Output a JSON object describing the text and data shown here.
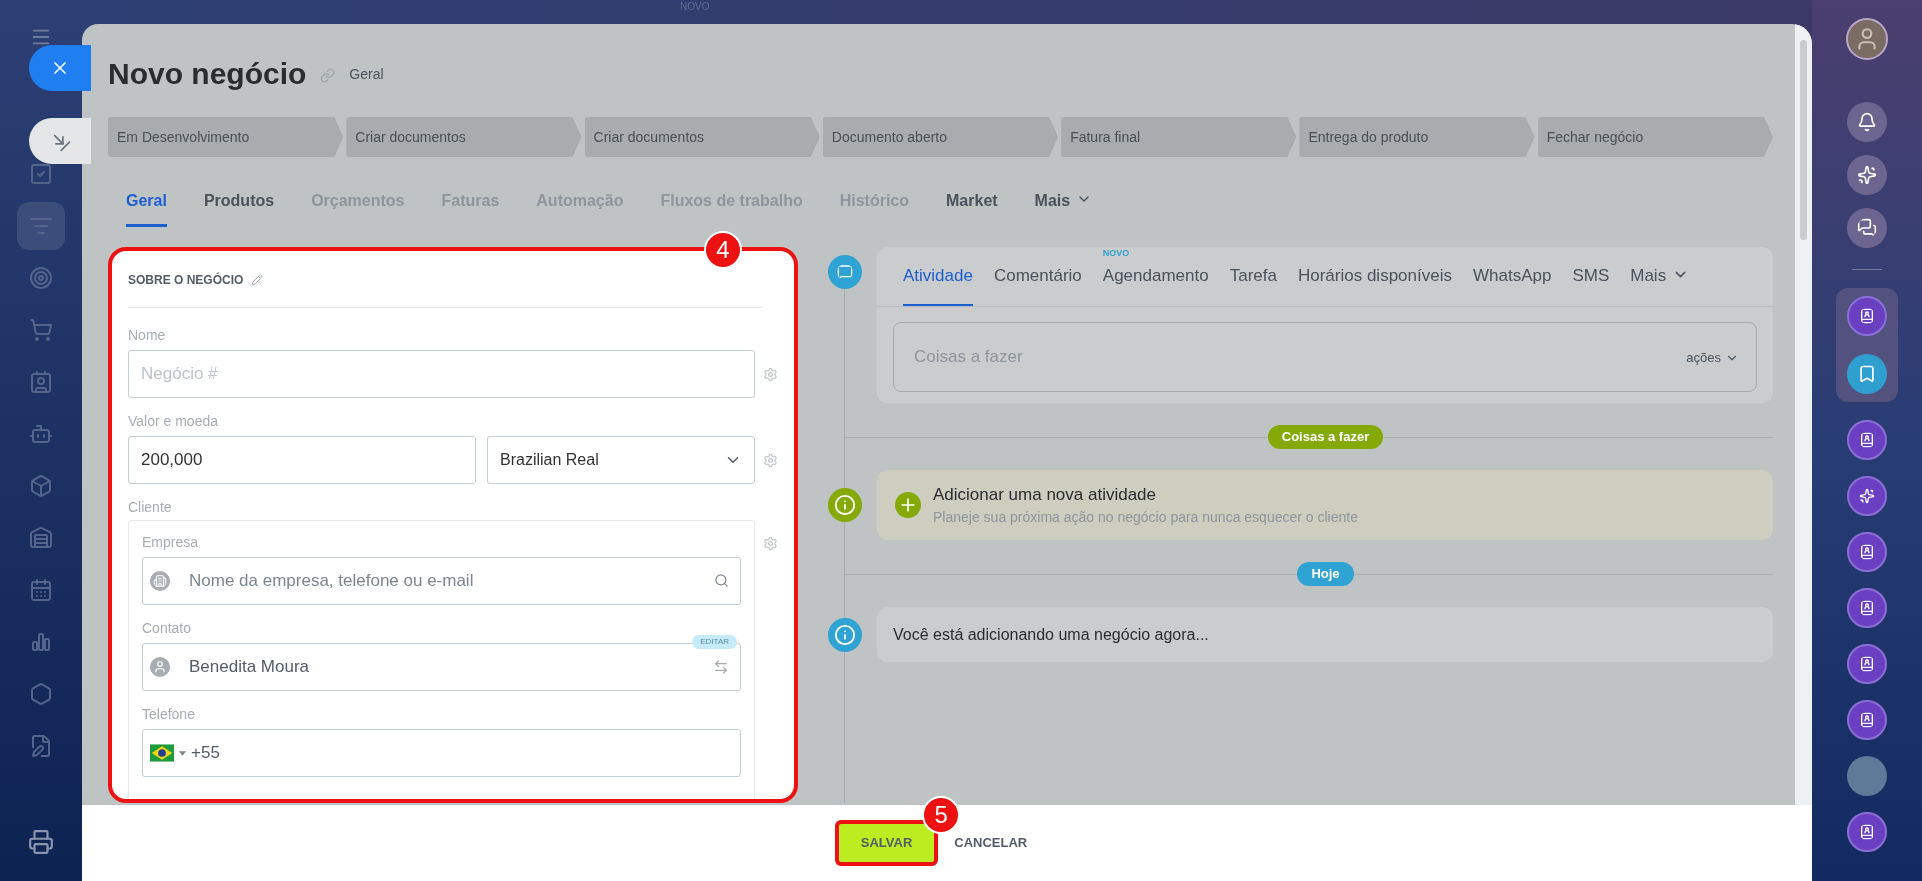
{
  "top_label": "NOVO",
  "title": "Novo negócio",
  "title_tag": "Geral",
  "stages": [
    {
      "label": "Em Desenvolvimento"
    },
    {
      "label": "Criar documentos"
    },
    {
      "label": "Criar documentos"
    },
    {
      "label": "Documento aberto"
    },
    {
      "label": "Fatura final"
    },
    {
      "label": "Entrega do produto"
    },
    {
      "label": "Fechar negócio"
    }
  ],
  "tabs": [
    {
      "label": "Geral",
      "selected": true,
      "disabled": false,
      "kind": "tab"
    },
    {
      "label": "Produtos",
      "selected": false,
      "disabled": false,
      "kind": "tab"
    },
    {
      "label": "Orçamentos",
      "selected": false,
      "disabled": true,
      "kind": "tab"
    },
    {
      "label": "Faturas",
      "selected": false,
      "disabled": true,
      "kind": "tab"
    },
    {
      "label": "Automação",
      "selected": false,
      "disabled": true,
      "kind": "tab"
    },
    {
      "label": "Fluxos de trabalho",
      "selected": false,
      "disabled": true,
      "kind": "tab"
    },
    {
      "label": "Histórico",
      "selected": false,
      "disabled": true,
      "kind": "tab"
    },
    {
      "label": "Market",
      "selected": false,
      "disabled": false,
      "kind": "tab"
    },
    {
      "label": "Mais",
      "selected": false,
      "disabled": false,
      "kind": "dropdown"
    }
  ],
  "form": {
    "callout": "4",
    "section_title": "SOBRE O NEGÓCIO",
    "name": {
      "label": "Nome",
      "placeholder": "Negócio #"
    },
    "amount": {
      "label": "Valor e moeda",
      "value": "200,000",
      "currency": "Brazilian Real"
    },
    "client": {
      "label": "Cliente",
      "company": {
        "label": "Empresa",
        "placeholder": "Nome da empresa, telefone ou e-mail"
      },
      "contact": {
        "label": "Contato",
        "value": "Benedita Moura",
        "badge": "EDITAR"
      },
      "phone": {
        "label": "Telefone",
        "value": "+55"
      }
    }
  },
  "timeline": {
    "activity_tabs": [
      {
        "label": "Atividade",
        "selected": true,
        "kind": "tab"
      },
      {
        "label": "Comentário",
        "selected": false,
        "kind": "tab"
      },
      {
        "label": "Agendamento",
        "selected": false,
        "kind": "tab",
        "badge": "NOVO"
      },
      {
        "label": "Tarefa",
        "selected": false,
        "kind": "tab"
      },
      {
        "label": "Horários disponíveis",
        "selected": false,
        "kind": "tab"
      },
      {
        "label": "WhatsApp",
        "selected": false,
        "kind": "tab"
      },
      {
        "label": "SMS",
        "selected": false,
        "kind": "tab"
      },
      {
        "label": "Mais",
        "selected": false,
        "kind": "dropdown"
      }
    ],
    "todo_placeholder": "Coisas a fazer",
    "actions_label": "ações",
    "sections": [
      {
        "label": "Coisas a fazer",
        "color": "#85aa07"
      },
      {
        "label": "Hoje",
        "color": "#2fa3d3"
      }
    ],
    "add_activity": {
      "title": "Adicionar uma nova atividade",
      "subtitle": "Planeje sua próxima ação no negócio para nunca esquecer o cliente"
    },
    "note": "Você está adicionando uma negócio agora..."
  },
  "footer": {
    "buttons": [
      {
        "label": "SALVAR",
        "kind": "primary",
        "callout": "5"
      },
      {
        "label": "CANCELAR",
        "kind": "link"
      }
    ]
  }
}
